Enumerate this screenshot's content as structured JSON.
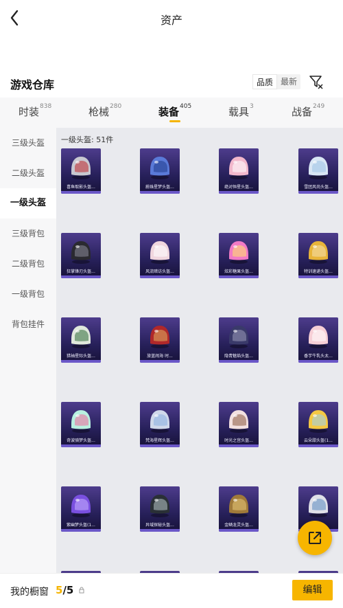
{
  "header": {
    "title": "资产"
  },
  "section": {
    "title": "游戏仓库",
    "sort_options": [
      "品质",
      "最新"
    ]
  },
  "tabs": [
    {
      "label": "时装",
      "count": "838"
    },
    {
      "label": "枪械",
      "count": "280"
    },
    {
      "label": "装备",
      "count": "405"
    },
    {
      "label": "载具",
      "count": "3"
    },
    {
      "label": "战备",
      "count": "249"
    }
  ],
  "sidebar": {
    "items": [
      "三级头盔",
      "二级头盔",
      "一级头盔",
      "三级背包",
      "二级背包",
      "一级背包",
      "背包挂件"
    ]
  },
  "content": {
    "count_label": "一级头盔: 51件",
    "items": [
      {
        "name": "喜鱼取影头盔...",
        "color": "#c8c8d0",
        "accent": "#c0282c"
      },
      {
        "name": "蔚珠星梦头盔...",
        "color": "#5a7ad8",
        "accent": "#203a8a"
      },
      {
        "name": "绝对恒星头盔...",
        "color": "#f2b8cc",
        "accent": "#ffffff"
      },
      {
        "name": "雪团风尚头盔...",
        "color": "#d8e6f4",
        "accent": "#9ec2e6"
      },
      {
        "name": "狂掌锋刃头盔...",
        "color": "#2a2a30",
        "accent": "#8a8a9a"
      },
      {
        "name": "风流暗访头盔...",
        "color": "#f0d6de",
        "accent": "#ffffff"
      },
      {
        "name": "炫彩糖果头盔...",
        "color": "#f27ac6",
        "accent": "#ffe36a"
      },
      {
        "name": "特训速递头盔...",
        "color": "#e8b43a",
        "accent": "#f4e0b0"
      },
      {
        "name": "猎袖星际头盔...",
        "color": "#e0e8dc",
        "accent": "#2f6b3a"
      },
      {
        "name": "旅蓝闹海 时...",
        "color": "#b0282a",
        "accent": "#e0b060"
      },
      {
        "name": "隐青魅焰头盔...",
        "color": "#3a3a6a",
        "accent": "#9a9ab8"
      },
      {
        "name": "香芋牛乳头太...",
        "color": "#f6cfd6",
        "accent": "#ffffff"
      },
      {
        "name": "奇波骑梦头盔...",
        "color": "#b8f0e0",
        "accent": "#f06a9a"
      },
      {
        "name": "梵海星辉头盔...",
        "color": "#cfd8ea",
        "accent": "#8ab0e0"
      },
      {
        "name": "时光之宫头盔...",
        "color": "#f2e0e0",
        "accent": "#8a5a40"
      },
      {
        "name": "云朵甜头盔(1...",
        "color": "#f4c844",
        "accent": "#9ad0f0"
      },
      {
        "name": "紫幽梦头盔(1...",
        "color": "#7a50e0",
        "accent": "#c6b0ff"
      },
      {
        "name": "异域探秘头盔...",
        "color": "#2a3036",
        "accent": "#b8c8c8"
      },
      {
        "name": "金鳞龙灵头盔...",
        "color": "#a07a3a",
        "accent": "#e8c878"
      },
      {
        "name": "赛...",
        "color": "#dfe0e8",
        "accent": "#5a8ac0"
      }
    ]
  },
  "bottom": {
    "label": "我的橱窗",
    "count_current": "5",
    "count_sep": "/",
    "count_total": "5",
    "edit_label": "编辑"
  },
  "colors": {
    "accent": "#f7b500",
    "card_bg": "#2e2466",
    "content_bg": "#e9eaee"
  }
}
